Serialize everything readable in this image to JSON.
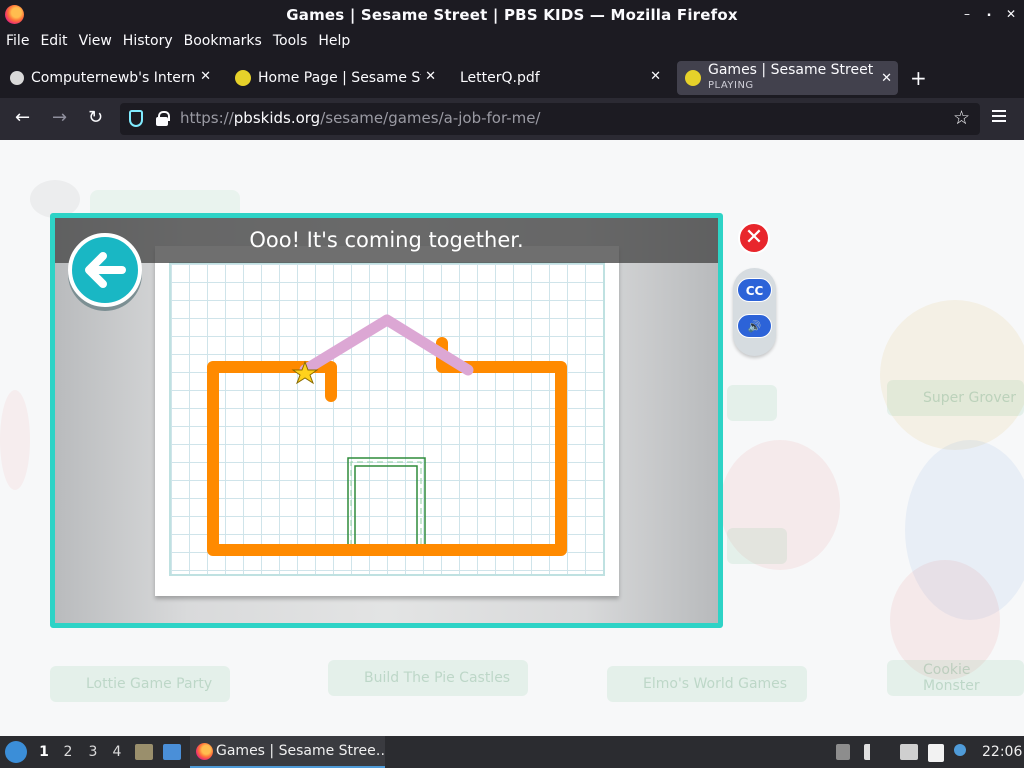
{
  "window": {
    "title": "Games | Sesame Street | PBS KIDS — Mozilla Firefox",
    "controls": {
      "minimize": "–",
      "maximize": "⬝",
      "close": "✕"
    }
  },
  "menu": [
    {
      "label": "File",
      "key": "F"
    },
    {
      "label": "Edit",
      "key": "E"
    },
    {
      "label": "View",
      "key": "V"
    },
    {
      "label": "History",
      "key": "s"
    },
    {
      "label": "Bookmarks",
      "key": "B"
    },
    {
      "label": "Tools",
      "key": "T"
    },
    {
      "label": "Help",
      "key": "H"
    }
  ],
  "tabs": [
    {
      "label": "Computernewb's Internet",
      "favicon": "document-icon"
    },
    {
      "label": "Home Page | Sesame Stre",
      "favicon": "sesame-icon"
    },
    {
      "label": "LetterQ.pdf",
      "favicon": "pdf-icon"
    },
    {
      "label": "Games | Sesame Street |",
      "sub": "PLAYING",
      "favicon": "sesame-icon",
      "active": true
    }
  ],
  "tab_close_glyph": "✕",
  "new_tab_glyph": "+",
  "nav": {
    "back": "←",
    "forward": "→",
    "reload": "↻",
    "url_prefix": "https://",
    "url_host": "pbskids.org",
    "url_path": "/sesame/games/a-job-for-me/",
    "bookmark_star": "☆"
  },
  "background_tiles": [
    "Lottie Game Party",
    "Build The Pie Castles",
    "Elmo's World Games",
    "Super Grover",
    "Cookie Monster"
  ],
  "game": {
    "message": "Ooo! It's coming together.",
    "close_glyph": "✕",
    "cc_label": "CC",
    "sound_glyph": "🔊",
    "colors": {
      "frame": "#2ed3c6",
      "house_outline": "#ff8a00",
      "roof": "#dca7d4",
      "door_guide": "#2e8b3a",
      "back_button": "#19b7c4",
      "close_button": "#e8262c",
      "control_buttons": "#2c63d8"
    }
  },
  "taskbar": {
    "workspaces": [
      "1",
      "2",
      "3",
      "4"
    ],
    "active_workspace": "1",
    "task_label": "Games | Sesame Stree…",
    "clock": "22:06"
  }
}
